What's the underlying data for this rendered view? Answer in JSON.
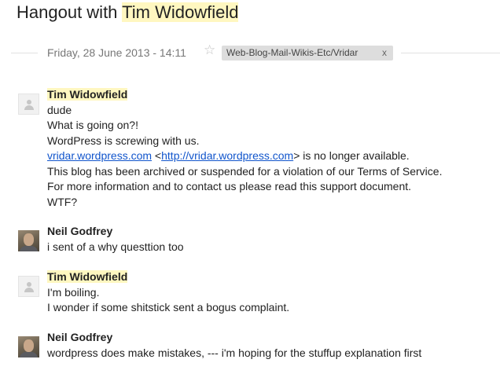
{
  "header": {
    "title_prefix": "Hangout with ",
    "title_name": "Tim Widowfield"
  },
  "meta": {
    "date": "Friday, 28 June 2013 - 14:11",
    "star": "☆",
    "label": "Web-Blog-Mail-Wikis-Etc/Vridar",
    "label_remove": "x"
  },
  "messages": [
    {
      "sender": "Tim Widowfield",
      "lines": [
        "dude",
        "What is going on?!",
        "WordPress is screwing with us."
      ],
      "link_line": {
        "link1": "vridar.wordpress.com",
        "open": " <",
        "link2": "http://vridar.wordpress.com",
        "close": "> is no longer available."
      },
      "after_lines": [
        "This blog has been archived or suspended for a violation of our Terms of Service.",
        "For more information and to contact us please read this support document.",
        "WTF?"
      ]
    },
    {
      "sender": "Neil Godfrey",
      "lines": [
        "i sent of a why questtion too"
      ]
    },
    {
      "sender": "Tim Widowfield",
      "lines": [
        "I'm boiling.",
        "I wonder if some shitstick sent a bogus complaint."
      ]
    },
    {
      "sender": "Neil Godfrey",
      "lines": [
        "wordpress does make mistakes, --- i'm hoping for the stuffup explanation first"
      ]
    }
  ]
}
